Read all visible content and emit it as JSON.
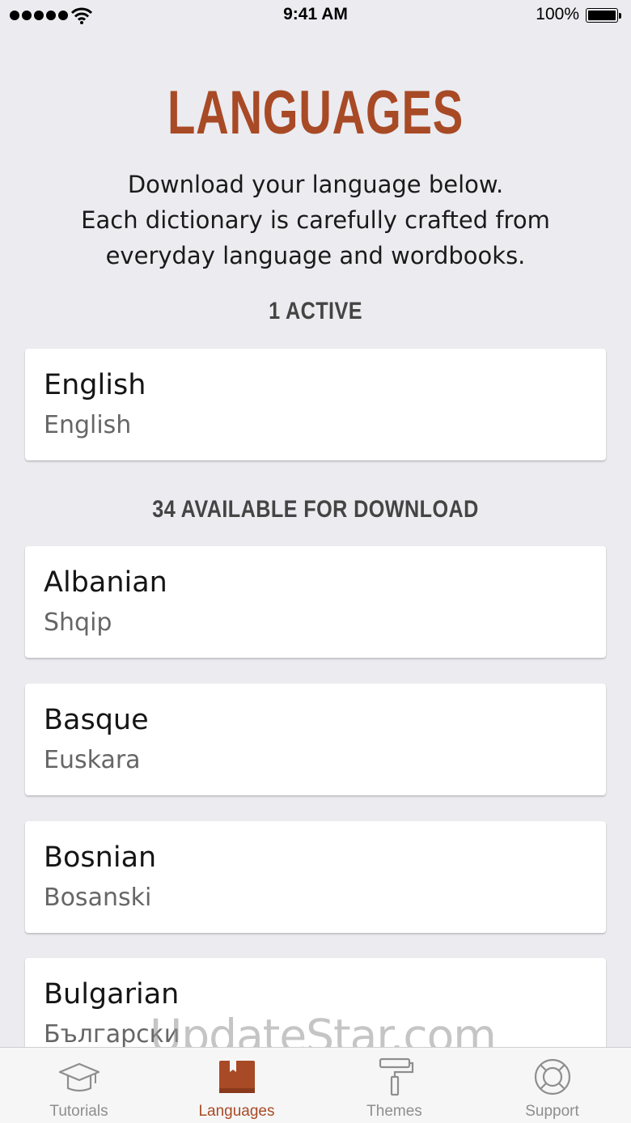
{
  "status_bar": {
    "time": "9:41 AM",
    "battery_pct": "100%",
    "signal_dots": 5
  },
  "header": {
    "title": "LANGUAGES",
    "intro_lines": [
      "Download your language below.",
      "Each dictionary is carefully crafted from",
      "everyday language and wordbooks."
    ]
  },
  "active_section": {
    "heading": "1 ACTIVE",
    "items": [
      {
        "name": "English",
        "native": "English"
      }
    ]
  },
  "download_section": {
    "heading": "34 AVAILABLE FOR DOWNLOAD",
    "items": [
      {
        "name": "Albanian",
        "native": "Shqip"
      },
      {
        "name": "Basque",
        "native": "Euskara"
      },
      {
        "name": "Bosnian",
        "native": "Bosanski"
      },
      {
        "name": "Bulgarian",
        "native": "Български"
      }
    ]
  },
  "tabs": [
    {
      "label": "Tutorials",
      "icon": "graduation-cap-icon",
      "active": false
    },
    {
      "label": "Languages",
      "icon": "book-icon",
      "active": true
    },
    {
      "label": "Themes",
      "icon": "paint-roller-icon",
      "active": false
    },
    {
      "label": "Support",
      "icon": "lifebuoy-icon",
      "active": false
    }
  ],
  "watermark": "UpdateStar.com",
  "colors": {
    "accent": "#a84a25",
    "background": "#ebebf0",
    "card": "#ffffff",
    "tab_inactive": "#8e8e8e"
  }
}
